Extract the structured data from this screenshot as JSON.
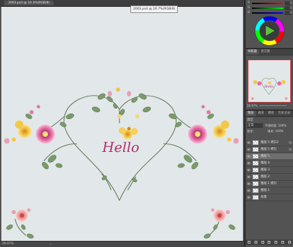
{
  "document": {
    "tab_title": "2003.psd @ 33.3%(RGB/8)",
    "filename_tooltip": "2003.psd @ 26.7%(RGB/8)",
    "canvas_text": "Hello",
    "background_color": "#e2e7e9",
    "text_color": "#b0306b"
  },
  "status_bar": {
    "zoom": "26.67%",
    "arrow": "›"
  },
  "color_panel": {
    "sliders": [
      {
        "label": "R",
        "value": "0"
      },
      {
        "label": "G",
        "value": "0"
      },
      {
        "label": "B",
        "value": "0"
      }
    ]
  },
  "navigator": {
    "tabs": [
      "导航器",
      "直方图"
    ],
    "zoom": "26.67%"
  },
  "layers_panel": {
    "tabs": [
      "图层",
      "通道",
      "路径",
      "历史记录"
    ],
    "kind_label": "类型",
    "blend_mode": "正常",
    "opacity_label": "不透明度:",
    "opacity_value": "100%",
    "lock_label": "锁定:",
    "fill_label": "填充:",
    "fill_value": "100%",
    "layers": [
      {
        "name": "图层 5 拷贝2",
        "fx": "fx"
      },
      {
        "name": "图层 5 拷贝",
        "fx": "fx"
      },
      {
        "name": "图层 5",
        "fx": ""
      },
      {
        "name": "图层 4",
        "fx": ""
      },
      {
        "name": "图层 3",
        "fx": ""
      },
      {
        "name": "图层 2",
        "fx": ""
      },
      {
        "name": "图层 1 拷贝",
        "fx": ""
      },
      {
        "name": "图层 1",
        "fx": ""
      },
      {
        "name": "背景",
        "fx": ""
      }
    ]
  }
}
